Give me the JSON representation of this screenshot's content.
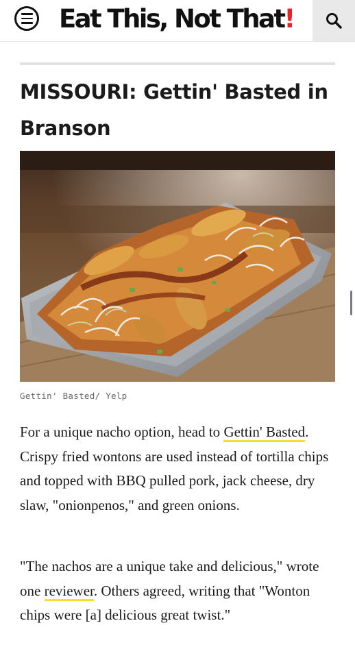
{
  "header": {
    "logo_text": "Eat This, Not That",
    "logo_bang": "!",
    "brand_color": "#e4262c",
    "menu_icon": "hamburger-menu-icon",
    "search_icon": "search-icon"
  },
  "article": {
    "headline": "MISSOURI: Gettin' Basted in Branson",
    "image_caption": "Gettin' Basted/ Yelp",
    "paragraph1": {
      "before": "For a unique nacho option, head to ",
      "link": "Gettin' Basted",
      "after": ". Crispy fried wontons are used instead of tortilla chips and topped with BBQ pulled pork, jack cheese, dry slaw, \"onionpenos,\" and green onions."
    },
    "paragraph2": {
      "before": "\"The nachos are a unique take and delicious,\" wrote one ",
      "link": "reviewer",
      "after": ". Others agreed, writing that \"Wonton chips were [a] delicious great twist.\""
    },
    "link_underline_color": "#f5e031"
  }
}
